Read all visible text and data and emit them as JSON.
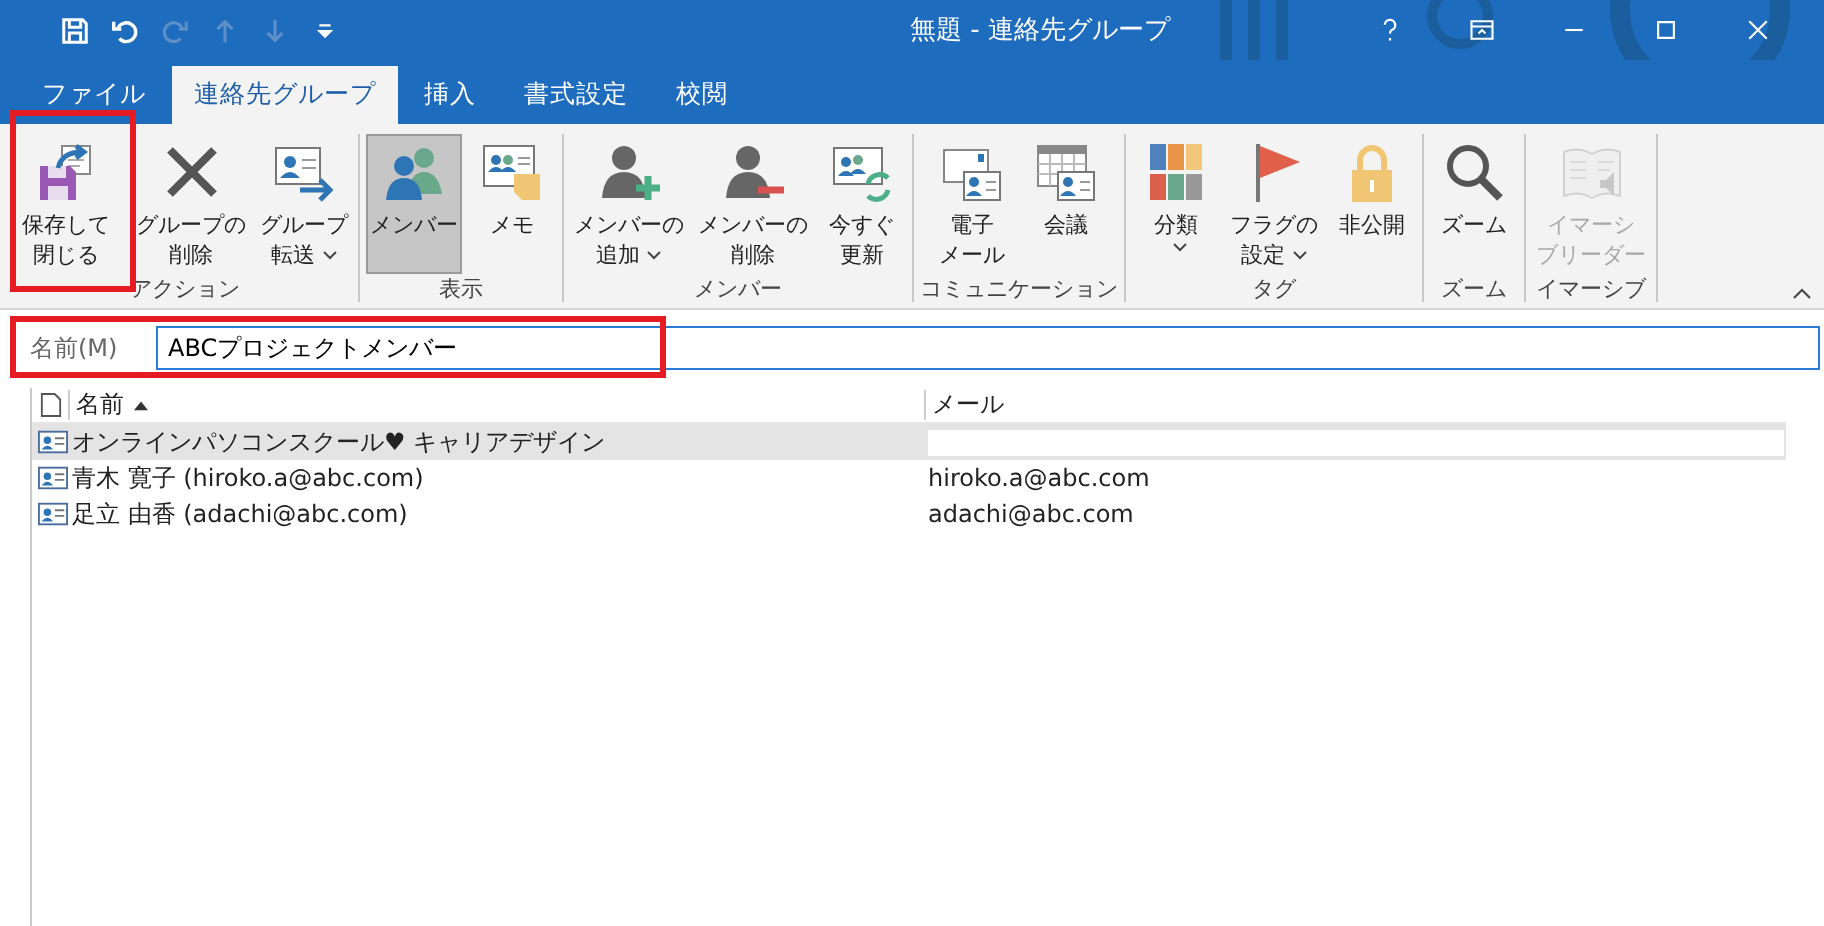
{
  "window": {
    "title": "無題 - 連絡先グループ"
  },
  "quick_access": [
    {
      "kind": "save",
      "disabled": false
    },
    {
      "kind": "undo",
      "disabled": false
    },
    {
      "kind": "redo",
      "disabled": true
    },
    {
      "kind": "up",
      "disabled": true
    },
    {
      "kind": "down",
      "disabled": true
    },
    {
      "kind": "customize",
      "disabled": false
    }
  ],
  "tabs": [
    {
      "label": "ファイル",
      "selected": false
    },
    {
      "label": "連絡先グループ",
      "selected": true
    },
    {
      "label": "挿入",
      "selected": false
    },
    {
      "label": "書式設定",
      "selected": false
    },
    {
      "label": "校閲",
      "selected": false
    }
  ],
  "ribbon": {
    "groups": [
      {
        "label": "アクション",
        "buttons": [
          {
            "kind": "save",
            "lines": [
              "保存して",
              "閉じる"
            ],
            "dropdown": false,
            "selected": false,
            "disabled": false
          },
          {
            "kind": "delete",
            "lines": [
              "グループの",
              "削除"
            ],
            "dropdown": false,
            "selected": false,
            "disabled": false
          },
          {
            "kind": "forward",
            "lines": [
              "グループ",
              "転送"
            ],
            "dropdown": true,
            "selected": false,
            "disabled": false
          }
        ]
      },
      {
        "label": "表示",
        "buttons": [
          {
            "kind": "members",
            "lines": [
              "メンバー"
            ],
            "dropdown": false,
            "selected": true,
            "disabled": false
          },
          {
            "kind": "notes",
            "lines": [
              "メモ"
            ],
            "dropdown": false,
            "selected": false,
            "disabled": false
          }
        ]
      },
      {
        "label": "メンバー",
        "buttons": [
          {
            "kind": "add-member",
            "lines": [
              "メンバーの",
              "追加"
            ],
            "dropdown": true,
            "selected": false,
            "disabled": false
          },
          {
            "kind": "remove-member",
            "lines": [
              "メンバーの",
              "削除"
            ],
            "dropdown": false,
            "selected": false,
            "disabled": false
          },
          {
            "kind": "refresh",
            "lines": [
              "今すぐ",
              "更新"
            ],
            "dropdown": false,
            "selected": false,
            "disabled": false
          }
        ]
      },
      {
        "label": "コミュニケーション",
        "buttons": [
          {
            "kind": "email",
            "lines": [
              "電子",
              "メール"
            ],
            "dropdown": false,
            "selected": false,
            "disabled": false
          },
          {
            "kind": "meeting",
            "lines": [
              "会議"
            ],
            "dropdown": false,
            "selected": false,
            "disabled": false
          }
        ]
      },
      {
        "label": "タグ",
        "buttons": [
          {
            "kind": "categorize",
            "lines": [
              "分類"
            ],
            "dropdown": true,
            "selected": false,
            "disabled": false
          },
          {
            "kind": "flag",
            "lines": [
              "フラグの",
              "設定"
            ],
            "dropdown": true,
            "selected": false,
            "disabled": false
          },
          {
            "kind": "private",
            "lines": [
              "非公開"
            ],
            "dropdown": false,
            "selected": false,
            "disabled": false
          }
        ]
      },
      {
        "label": "ズーム",
        "buttons": [
          {
            "kind": "zoom",
            "lines": [
              "ズーム"
            ],
            "dropdown": false,
            "selected": false,
            "disabled": false
          }
        ]
      },
      {
        "label": "イマーシブ",
        "buttons": [
          {
            "kind": "reader",
            "lines": [
              "イマーシ",
              "ブリーダー"
            ],
            "dropdown": false,
            "selected": false,
            "disabled": true
          }
        ]
      }
    ]
  },
  "name_field": {
    "label": "名前(M)",
    "value": "ABCプロジェクトメンバー"
  },
  "members": {
    "columns": [
      {
        "label": "名前",
        "sorted_ascending": true
      },
      {
        "label": "メール"
      }
    ],
    "rows": [
      {
        "name": "オンラインパソコンスクール♥ キャリアデザイン",
        "selected": true,
        "email_hidden": true
      },
      {
        "name": "青木 寛子 (hiroko.a@abc.com)",
        "email": "hiroko.a@abc.com",
        "selected": false,
        "email_hidden": false
      },
      {
        "name": "足立 由香 (adachi@abc.com)",
        "email": "adachi@abc.com",
        "selected": false,
        "email_hidden": false
      }
    ]
  }
}
